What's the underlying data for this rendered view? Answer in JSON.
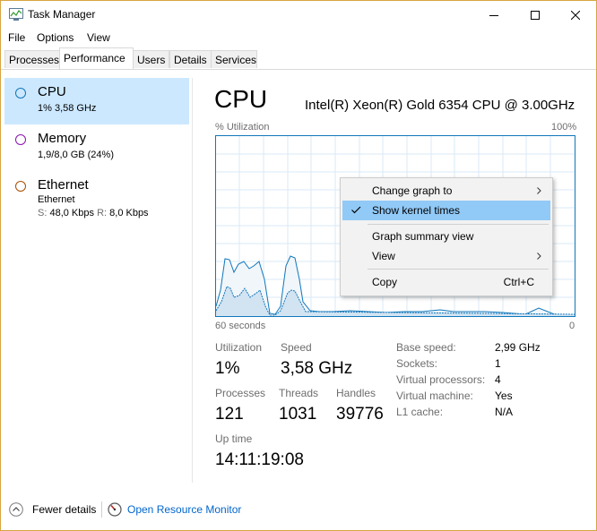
{
  "window": {
    "title": "Task Manager",
    "controls": {
      "minimize_icon": "minimize-icon",
      "maximize_icon": "maximize-icon",
      "close_icon": "close-icon"
    }
  },
  "menu": {
    "items": [
      "File",
      "Options",
      "View"
    ]
  },
  "tabs": [
    {
      "label": "Processes",
      "active": false
    },
    {
      "label": "Performance",
      "active": true
    },
    {
      "label": "Users",
      "active": false
    },
    {
      "label": "Details",
      "active": false
    },
    {
      "label": "Services",
      "active": false
    }
  ],
  "sidebar": {
    "items": [
      {
        "title": "CPU",
        "sub": "1% 3,58 GHz",
        "color": "#1177bb",
        "selected": true
      },
      {
        "title": "Memory",
        "sub": "1,9/8,0 GB (24%)",
        "color": "#8b12ae",
        "selected": false
      },
      {
        "title": "Ethernet",
        "sub": "Ethernet",
        "sub2_s_label": "S:",
        "sub2_s_value": "48,0 Kbps",
        "sub2_r_label": "R:",
        "sub2_r_value": "8,0 Kbps",
        "color": "#a74f01",
        "selected": false
      }
    ]
  },
  "cpu": {
    "title": "CPU",
    "model": "Intel(R) Xeon(R) Gold 6354 CPU @ 3.00GHz",
    "graph": {
      "ylabel": "% Utilization",
      "ymax_label": "100%",
      "xlabel_left": "60 seconds",
      "xlabel_right": "0",
      "accent": "#1177bb",
      "fill": "#f1f6fa"
    },
    "stats": {
      "utilization_label": "Utilization",
      "utilization": "1%",
      "speed_label": "Speed",
      "speed": "3,58 GHz",
      "processes_label": "Processes",
      "processes": "121",
      "threads_label": "Threads",
      "threads": "1031",
      "handles_label": "Handles",
      "handles": "39776",
      "uptime_label": "Up time",
      "uptime": "14:11:19:08"
    },
    "specs": [
      {
        "label": "Base speed:",
        "value": "2,99 GHz"
      },
      {
        "label": "Sockets:",
        "value": "1"
      },
      {
        "label": "Virtual processors:",
        "value": "4"
      },
      {
        "label": "Virtual machine:",
        "value": "Yes"
      },
      {
        "label": "L1 cache:",
        "value": "N/A"
      }
    ]
  },
  "context_menu": {
    "items": [
      {
        "label": "Change graph to",
        "submenu": true
      },
      {
        "label": "Show kernel times",
        "checked": true
      },
      {
        "label": "Graph summary view"
      },
      {
        "label": "View",
        "submenu": true
      },
      {
        "label": "Copy",
        "shortcut": "Ctrl+C"
      }
    ]
  },
  "footer": {
    "fewer_details": "Fewer details",
    "resource_monitor": "Open Resource Monitor"
  }
}
